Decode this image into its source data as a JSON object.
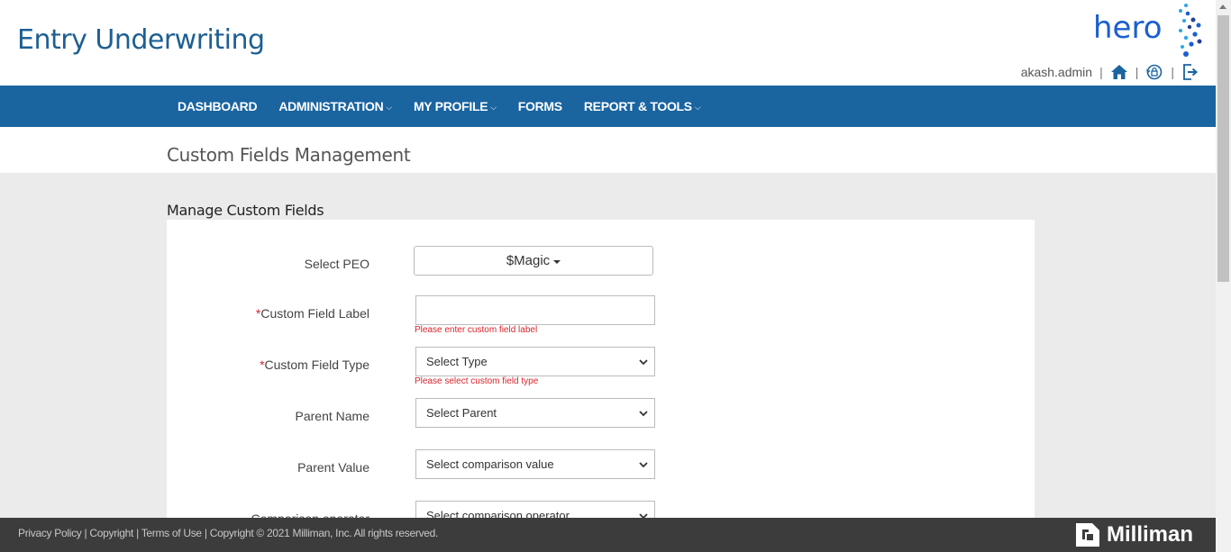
{
  "app": {
    "title": "Entry Underwriting"
  },
  "logo": {
    "text": "hero"
  },
  "user": {
    "name": "akash.admin",
    "separator": "|"
  },
  "nav": {
    "items": [
      {
        "label": "DASHBOARD",
        "has_dropdown": false
      },
      {
        "label": "ADMINISTRATION",
        "has_dropdown": true
      },
      {
        "label": "MY PROFILE",
        "has_dropdown": true
      },
      {
        "label": "FORMS",
        "has_dropdown": false
      },
      {
        "label": "REPORT & TOOLS",
        "has_dropdown": true
      }
    ],
    "chevron": "⌵"
  },
  "page": {
    "title": "Custom Fields Management"
  },
  "section": {
    "title": "Manage Custom Fields"
  },
  "form": {
    "peo": {
      "label": "Select PEO",
      "value": "$Magic"
    },
    "custom_field_label": {
      "required_mark": "*",
      "label": "Custom Field Label",
      "value": "",
      "error": "Please enter custom field label"
    },
    "custom_field_type": {
      "required_mark": "*",
      "label": "Custom Field Type",
      "value": "Select Type",
      "error": "Please select custom field type"
    },
    "parent_name": {
      "label": "Parent Name",
      "value": "Select Parent"
    },
    "parent_value": {
      "label": "Parent Value",
      "value": "Select comparison value"
    },
    "comparison_operator": {
      "label": "Comparison operator",
      "value": "Select comparison operator"
    }
  },
  "footer": {
    "links": [
      "Privacy Policy",
      "Copyright",
      "Terms of Use"
    ],
    "copyright": "Copyright © 2021 Milliman, Inc. All rights reserved.",
    "brand": "Milliman"
  },
  "colors": {
    "brand_blue": "#1a64a0",
    "title_blue": "#1d5f93",
    "error_red": "#d9242c",
    "footer_bg": "#3c3c3c"
  },
  "icons": [
    "home-icon",
    "lock-refresh-icon",
    "logout-icon",
    "milliman-logo-icon"
  ]
}
